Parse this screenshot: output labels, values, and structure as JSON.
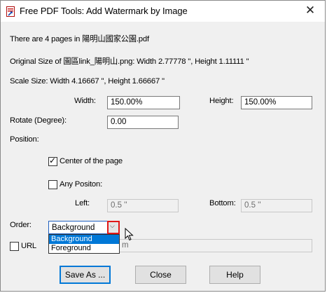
{
  "window": {
    "title": "Free PDF Tools: Add Watermark by Image",
    "close_glyph": "✕"
  },
  "info": {
    "pages": "There are 4 pages in 陽明山國家公園.pdf",
    "original_size": "Original Size of 園區link_陽明山.png:  Width 2.77778 '',   Height 1.11111 ''",
    "scale_size": "Scale Size:  Width 4.16667 '',   Height 1.66667 ''"
  },
  "form": {
    "width_label": "Width:",
    "width_value": "150.00%",
    "height_label": "Height:",
    "height_value": "150.00%",
    "rotate_label": "Rotate (Degree):",
    "rotate_value": "0.00",
    "position_label": "Position:",
    "center_label": "Center of the page",
    "center_checked": true,
    "any_position_label": "Any Positon:",
    "any_position_checked": false,
    "left_label": "Left:",
    "left_value": "0.5 ''",
    "bottom_label": "Bottom:",
    "bottom_value": "0.5 ''",
    "order_label": "Order:",
    "order_value": "Background",
    "order_options": [
      "Background",
      "Foreground"
    ],
    "url_label": "URL",
    "url_checked": false,
    "url_value": "m"
  },
  "buttons": {
    "save_as": "Save As ...",
    "close": "Close",
    "help": "Help"
  }
}
